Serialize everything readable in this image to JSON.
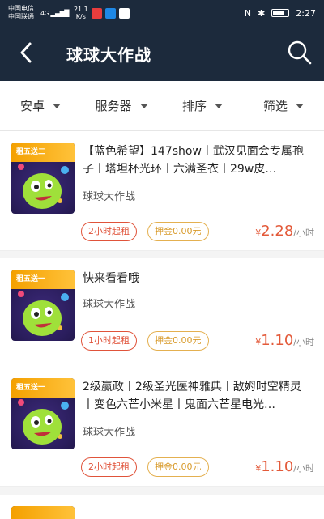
{
  "status_bar": {
    "carrier1": "中国电信",
    "carrier2": "中国联通",
    "signal": "4G",
    "net_speed": "21.1",
    "net_unit": "K/s",
    "time": "2:27"
  },
  "navbar": {
    "title": "球球大作战"
  },
  "filters": [
    {
      "label": "安卓"
    },
    {
      "label": "服务器"
    },
    {
      "label": "排序"
    },
    {
      "label": "筛选"
    }
  ],
  "items": [
    {
      "tag": "租五送二",
      "title": "【蓝色希望】147show丨武汉见面会专属孢子丨塔坦杯光环丨六满圣衣丨29w皮…",
      "game": "球球大作战",
      "rent_label": "2小时起租",
      "deposit_label": "押金0.00元",
      "currency": "¥",
      "price": "2.28",
      "price_unit": "/小时"
    },
    {
      "tag": "租五送一",
      "title": "快来看看哦",
      "game": "球球大作战",
      "rent_label": "1小时起租",
      "deposit_label": "押金0.00元",
      "currency": "¥",
      "price": "1.10",
      "price_unit": "/小时"
    },
    {
      "tag": "租五送一",
      "title": "2级赢政丨2级圣光医神雅典丨敌姆时空精灵丨变色六芒小米星丨鬼面六芒星电光…",
      "game": "球球大作战",
      "rent_label": "2小时起租",
      "deposit_label": "押金0.00元",
      "currency": "¥",
      "price": "1.10",
      "price_unit": "/小时"
    }
  ],
  "colors": {
    "header_bg": "#1c2a3c",
    "price": "#e35a3a",
    "rent_tag": "#e0533a",
    "deposit_tag": "#d89a2a",
    "promo_tag": "#f4a000"
  },
  "icons": {
    "back": "chevron-left-icon",
    "search": "search-icon",
    "caret": "caret-down-icon"
  }
}
